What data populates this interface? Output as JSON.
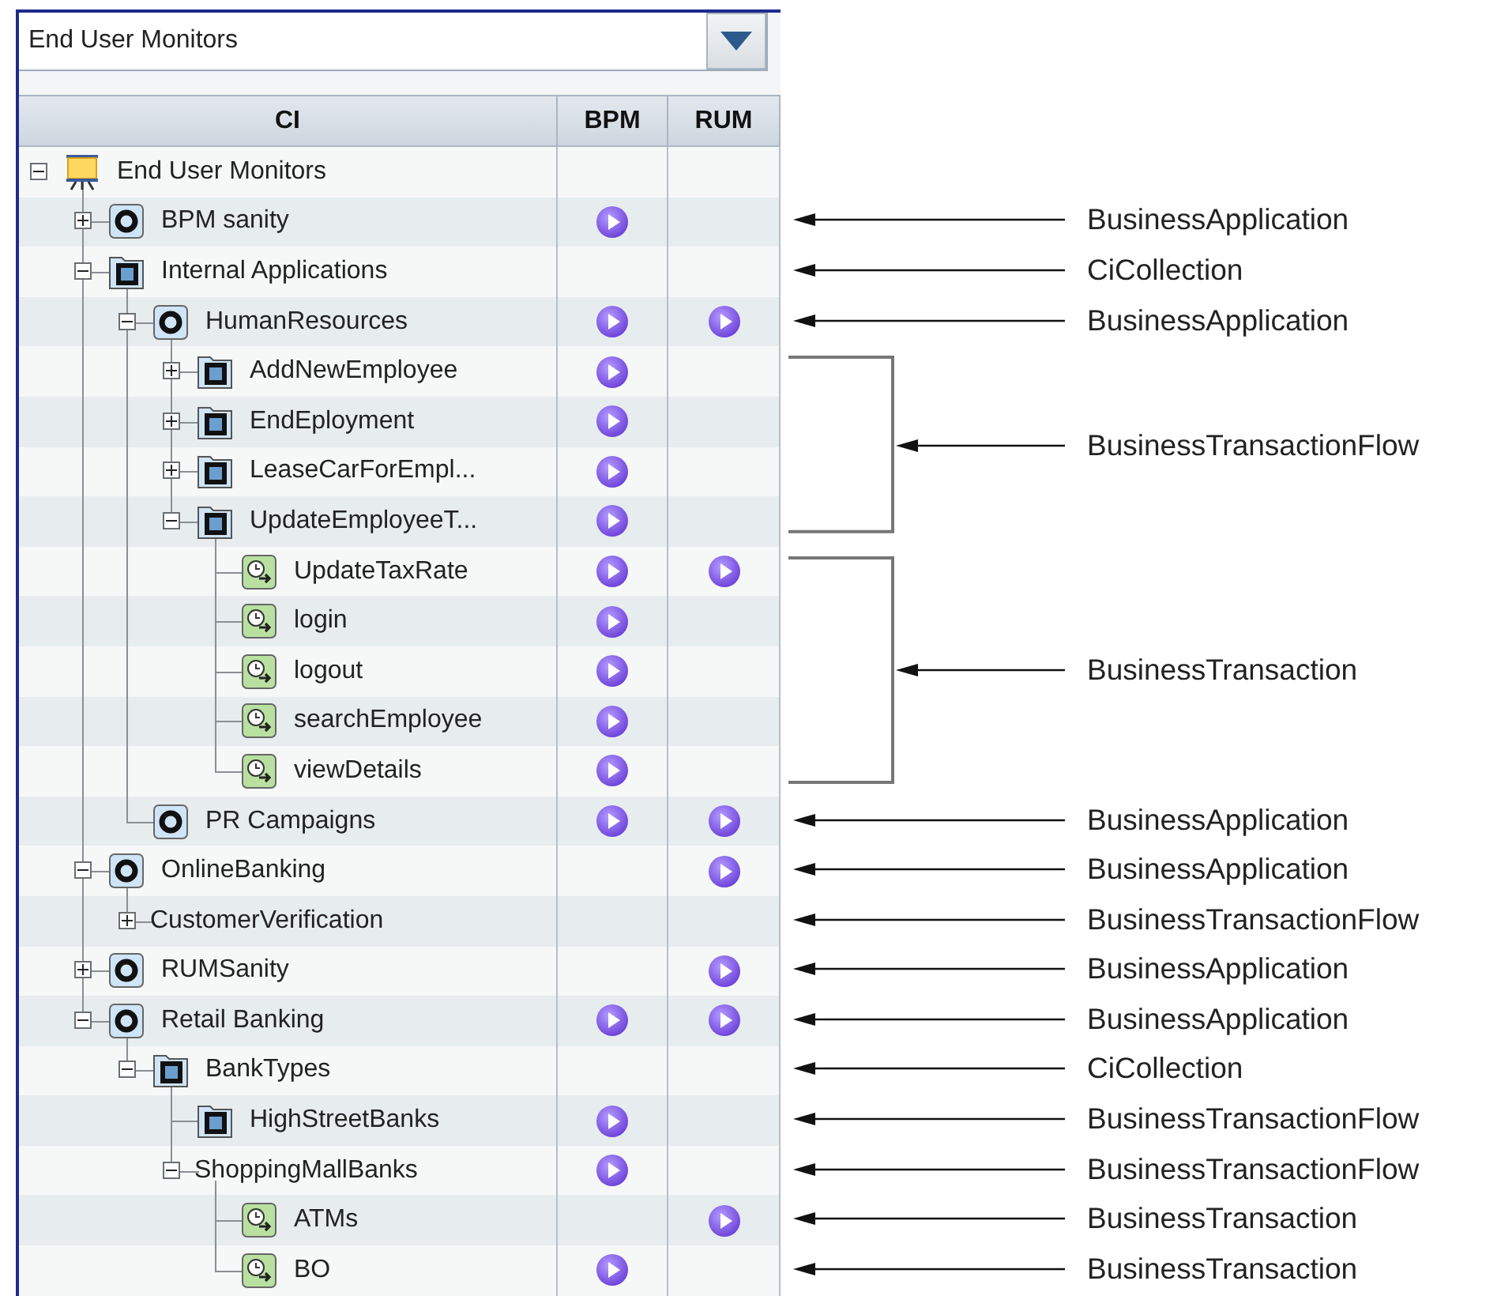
{
  "dropdown": {
    "value": "End User Monitors"
  },
  "table": {
    "columns": [
      "CI",
      "BPM",
      "RUM"
    ],
    "rows": [
      {
        "label": "End User Monitors",
        "kind": "root",
        "expanded": true,
        "bpm": false,
        "rum": false,
        "children": [
          {
            "label": "BPM sanity",
            "kind": "application",
            "expanded": false,
            "bpm": true,
            "rum": false,
            "annotation": "BusinessApplication"
          },
          {
            "label": "Internal Applications",
            "kind": "collection",
            "expanded": true,
            "bpm": false,
            "rum": false,
            "annotation": "CiCollection",
            "children": [
              {
                "label": "HumanResources",
                "kind": "application",
                "expanded": true,
                "bpm": true,
                "rum": true,
                "annotation": "BusinessApplication",
                "children_annotation": "BusinessTransactionFlow",
                "children": [
                  {
                    "label": "AddNewEmployee",
                    "kind": "collection",
                    "expanded": false,
                    "bpm": true,
                    "rum": false
                  },
                  {
                    "label": "EndEployment",
                    "kind": "collection",
                    "expanded": false,
                    "bpm": true,
                    "rum": false
                  },
                  {
                    "label": "LeaseCarForEmpl...",
                    "kind": "collection",
                    "expanded": false,
                    "bpm": true,
                    "rum": false
                  },
                  {
                    "label": "UpdateEmployeeT...",
                    "kind": "collection",
                    "expanded": true,
                    "bpm": true,
                    "rum": false,
                    "children_annotation": "BusinessTransaction",
                    "children": [
                      {
                        "label": "UpdateTaxRate",
                        "kind": "transaction",
                        "bpm": true,
                        "rum": true
                      },
                      {
                        "label": "login",
                        "kind": "transaction",
                        "bpm": true,
                        "rum": false
                      },
                      {
                        "label": "logout",
                        "kind": "transaction",
                        "bpm": true,
                        "rum": false
                      },
                      {
                        "label": "searchEmployee",
                        "kind": "transaction",
                        "bpm": true,
                        "rum": false
                      },
                      {
                        "label": "viewDetails",
                        "kind": "transaction",
                        "bpm": true,
                        "rum": false
                      }
                    ]
                  }
                ]
              },
              {
                "label": "PR Campaigns",
                "kind": "application",
                "bpm": true,
                "rum": true,
                "annotation": "BusinessApplication"
              }
            ]
          },
          {
            "label": "OnlineBanking",
            "kind": "application",
            "expanded": true,
            "bpm": false,
            "rum": true,
            "annotation": "BusinessApplication",
            "children": [
              {
                "label": "CustomerVerification",
                "expanded": false,
                "bpm": false,
                "rum": false,
                "annotation": "BusinessTransactionFlow"
              }
            ]
          },
          {
            "label": "RUMSanity",
            "kind": "application",
            "expanded": false,
            "bpm": false,
            "rum": true,
            "annotation": "BusinessApplication"
          },
          {
            "label": "Retail Banking",
            "kind": "application",
            "expanded": true,
            "bpm": true,
            "rum": true,
            "annotation": "BusinessApplication",
            "children": [
              {
                "label": "BankTypes",
                "kind": "collection",
                "expanded": true,
                "bpm": false,
                "rum": false,
                "annotation": "CiCollection",
                "children": [
                  {
                    "label": "HighStreetBanks",
                    "kind": "collection",
                    "bpm": true,
                    "rum": false,
                    "annotation": "BusinessTransactionFlow"
                  },
                  {
                    "label": "ShoppingMallBanks",
                    "expanded": true,
                    "bpm": true,
                    "rum": false,
                    "annotation": "BusinessTransactionFlow",
                    "children": [
                      {
                        "label": "ATMs",
                        "kind": "transaction",
                        "bpm": false,
                        "rum": true,
                        "annotation": "BusinessTransaction"
                      },
                      {
                        "label": "BO",
                        "kind": "transaction",
                        "bpm": true,
                        "rum": false,
                        "annotation": "BusinessTransaction"
                      }
                    ]
                  }
                ]
              }
            ]
          }
        ]
      }
    ]
  }
}
